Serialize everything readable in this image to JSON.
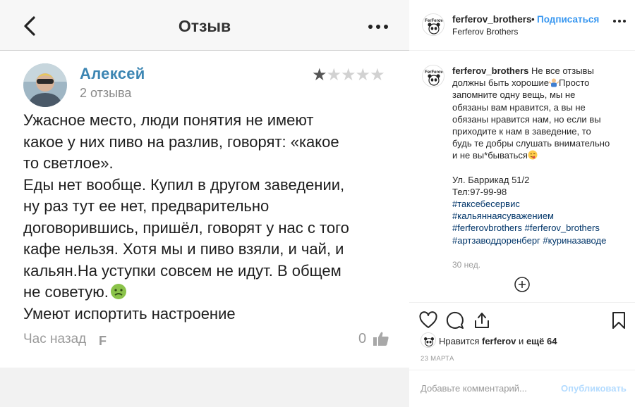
{
  "screenshot": {
    "title": "Отзыв",
    "review": {
      "author": "Алексей",
      "review_count": "2 отзыва",
      "rating": 1,
      "rating_max": 5,
      "text_lines": [
        "Ужасное место, люди понятия не имеют",
        "какое у них пиво на разлив, говорят: «какое",
        "то светлое».",
        "Еды нет вообще. Купил в другом заведении,",
        "ну раз тут ее нет, предварительно",
        "договорившись, пришёл, говорят у нас с того",
        "кафе нельзя. Хотя мы и пиво взяли, и чай, и",
        "кальян.На уступки совсем не идут.  В общем",
        "не советую.",
        "Умеют испортить настроение"
      ],
      "time": "Час назад",
      "flag_glyph": "F",
      "likes": "0"
    }
  },
  "post": {
    "username": "ferferov_brothers",
    "dot": "•",
    "follow_label": "Подписаться",
    "subtitle": "Ferferov Brothers",
    "logo_text": "FerFerov",
    "caption": {
      "user": "ferferov_brothers",
      "lines": [
        "Не все отзывы",
        "должны быть хорошие",
        "Просто",
        "запомните одну вещь, мы не",
        "обязаны вам нравится, а вы не",
        "обязаны нравится нам, но если вы",
        "приходите к нам в заведение, то",
        "будь те добры слушать внимательно",
        "и не вы*бываться"
      ],
      "address": "Ул. Баррикад 51/2",
      "phone": "Тел:97-99-98",
      "tags": [
        "#таксебесервис",
        "#кальяннаясуважением",
        "#ferferovbrothers",
        "#ferferov_brothers",
        "#артзаводдоренберг",
        "#куриназаводе"
      ]
    },
    "age": "30 нед.",
    "likes": {
      "prefix": "Нравится",
      "user": "ferferov",
      "joiner": "и",
      "others": "ещё 64"
    },
    "date": "23 МАРТА",
    "comment_placeholder": "Добавьте комментарий...",
    "publish_label": "Опубликовать"
  },
  "icons": {
    "back": "chevron-left-icon",
    "more": "more-icon",
    "like": "heart-icon",
    "comment": "comment-icon",
    "share": "share-icon",
    "save": "bookmark-icon",
    "load_more": "plus-circle-icon",
    "review_like": "thumbs-up-icon"
  },
  "colors": {
    "link_blue": "#3897f0",
    "tag_blue": "#003569",
    "review_name": "#3d86b3",
    "publish_disabled": "#b3dbff"
  }
}
